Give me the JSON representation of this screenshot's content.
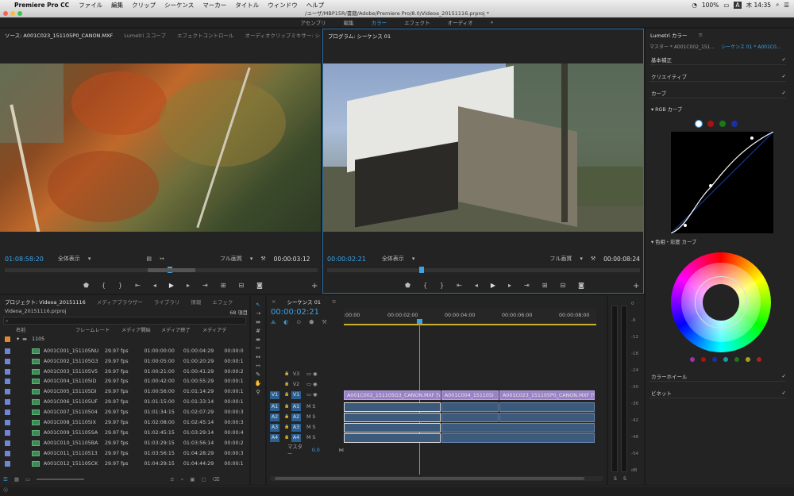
{
  "menubar": {
    "app": "Premiere Pro CC",
    "items": [
      "ファイル",
      "編集",
      "クリップ",
      "シーケンス",
      "マーカー",
      "タイトル",
      "ウィンドウ",
      "ヘルプ"
    ],
    "battery": "100%",
    "input": "A",
    "clock": "木 14:35"
  },
  "window": {
    "title": "/ユーザ/MBP15R/書籍/Adobe/Premiere Pro/8.0/Videoa_20151116.prproj *"
  },
  "workspaces": [
    "アセンブリ",
    "編集",
    "カラー",
    "エフェクト",
    "オーディオ"
  ],
  "source": {
    "tabs": [
      "ソース: A001C023_151105P0_CANON.MXF",
      "Lumetri スコープ",
      "エフェクトコントロール",
      "オーディオクリップミキサー: シ"
    ],
    "timecode": "01:08:58:20",
    "fit": "全体表示",
    "quality": "フル画質",
    "duration": "00:00:03:12"
  },
  "program": {
    "tabs": [
      "プログラム: シーケンス 01"
    ],
    "timecode": "00:00:02:21",
    "fit": "全体表示",
    "quality": "フル画質",
    "duration": "00:00:08:24"
  },
  "lumetri": {
    "title": "Lumetri カラー",
    "master": "マスター * A001C002_151...",
    "seq": "シーケンス 01 * A001C0...",
    "sections": [
      "基本補正",
      "クリエイティブ",
      "カーブ"
    ],
    "rgb_label": "RGB カーブ",
    "hue_label": "色相・彩度 カーブ",
    "wheel_label": "カラーホイール",
    "vignette_label": "ビネット"
  },
  "project": {
    "tabs": [
      "プロジェクト: Videoa_20151116",
      "メディアブラウザー",
      "ライブラリ",
      "情報",
      "エフェク"
    ],
    "file": "Videoa_20151116.prproj",
    "count": "68 項目",
    "columns": [
      "名前",
      "フレームレート",
      "メディア開始",
      "メディア終了",
      "メディアデ"
    ],
    "folder": "1105",
    "rows": [
      {
        "name": "A001C001_151105NU",
        "fps": "29.97 fps",
        "start": "01:00:00:00",
        "end": "01:00:04:29",
        "dur": "00:00:0"
      },
      {
        "name": "A001C002_151105G3",
        "fps": "29.97 fps",
        "start": "01:00:05:00",
        "end": "01:00:20:29",
        "dur": "00:00:1"
      },
      {
        "name": "A001C003_151105V5",
        "fps": "29.97 fps",
        "start": "01:00:21:00",
        "end": "01:00:41:29",
        "dur": "00:00:2"
      },
      {
        "name": "A001C004_151105ID",
        "fps": "29.97 fps",
        "start": "01:00:42:00",
        "end": "01:00:55:29",
        "dur": "00:00:1"
      },
      {
        "name": "A001C005_151105DI",
        "fps": "29.97 fps",
        "start": "01:00:56:00",
        "end": "01:01:14:29",
        "dur": "00:00:1"
      },
      {
        "name": "A001C006_151105UF",
        "fps": "29.97 fps",
        "start": "01:01:15:00",
        "end": "01:01:33:14",
        "dur": "00:00:1"
      },
      {
        "name": "A001C007_15110504",
        "fps": "29.97 fps",
        "start": "01:01:34:15",
        "end": "01:02:07:29",
        "dur": "00:00:3"
      },
      {
        "name": "A001C008_151105IX",
        "fps": "29.97 fps",
        "start": "01:02:08:00",
        "end": "01:02:45:14",
        "dur": "00:00:3"
      },
      {
        "name": "A001C009_151105SA",
        "fps": "29.97 fps",
        "start": "01:02:45:15",
        "end": "01:03:29:14",
        "dur": "00:00:4"
      },
      {
        "name": "A001C010_151105BA",
        "fps": "29.97 fps",
        "start": "01:03:29:15",
        "end": "01:03:56:14",
        "dur": "00:00:2"
      },
      {
        "name": "A001C011_15110513",
        "fps": "29.97 fps",
        "start": "01:03:56:15",
        "end": "01:04:28:29",
        "dur": "00:00:3"
      },
      {
        "name": "A001C012_151105CK",
        "fps": "29.97 fps",
        "start": "01:04:29:15",
        "end": "01:04:44:29",
        "dur": "00:00:1"
      }
    ]
  },
  "timeline": {
    "tab": "シーケンス 01",
    "timecode": "00:00:02:21",
    "ruler": [
      ":00:00",
      "00:00:02:00",
      "00:00:04:00",
      "00:00:06:00",
      "00:00:08:00"
    ],
    "vtracks": [
      "V3",
      "V2",
      "V1"
    ],
    "atracks": [
      "A1",
      "A2",
      "A3",
      "A4"
    ],
    "master": "マスター",
    "master_val": "0.0",
    "clips": [
      "A001C002_151105G3_CANON.MXF [V]",
      "A001C004_151105I",
      "A001C023_151105P0_CANON.MXF [V]"
    ]
  },
  "meter": {
    "scale": [
      "0",
      "-6",
      "-12",
      "-18",
      "-24",
      "-30",
      "-36",
      "-42",
      "-48",
      "-54",
      "dB"
    ],
    "solo": [
      "S",
      "S"
    ]
  }
}
